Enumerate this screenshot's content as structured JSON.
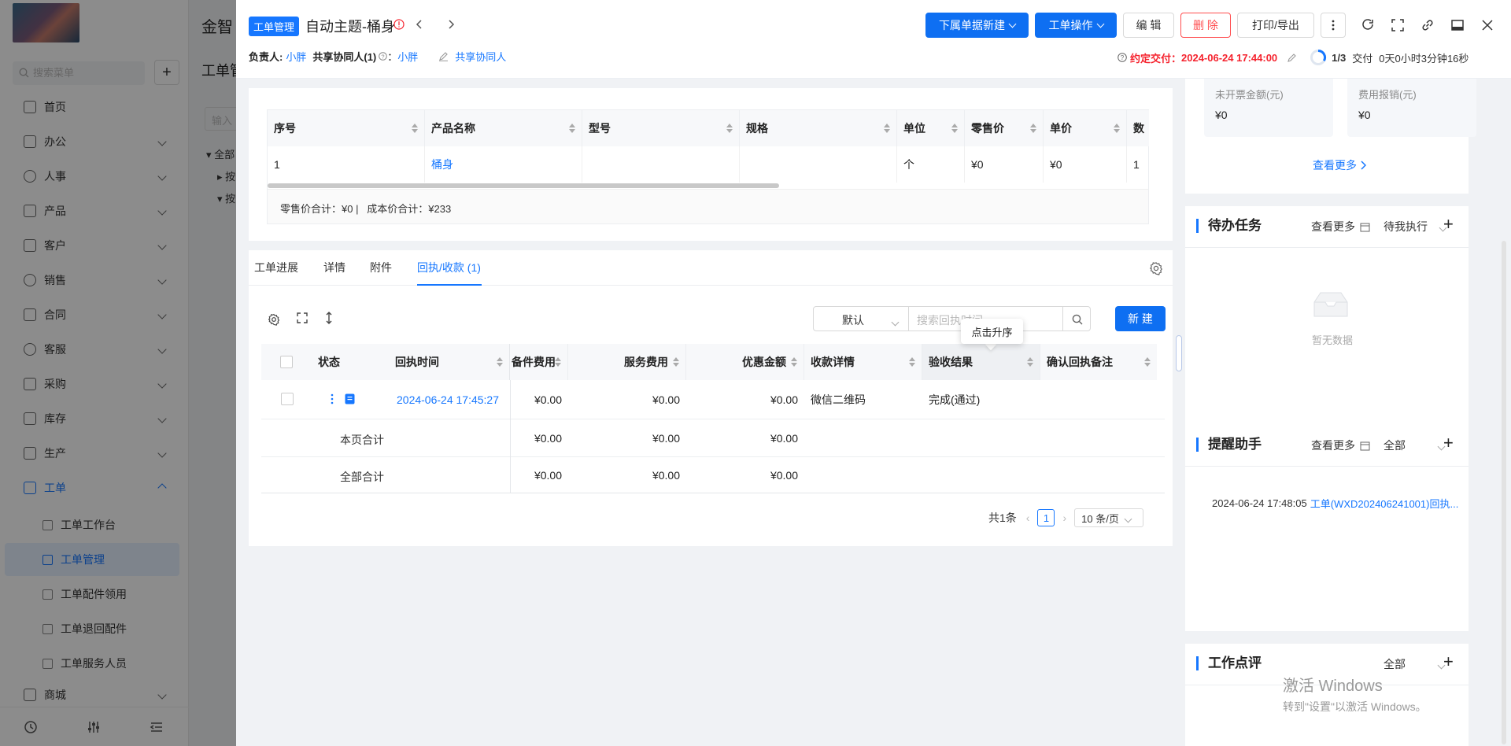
{
  "app": {
    "brand": "金智",
    "search_placeholder": "搜索菜单",
    "menu": [
      {
        "label": "首页"
      },
      {
        "label": "办公"
      },
      {
        "label": "人事"
      },
      {
        "label": "产品"
      },
      {
        "label": "客户"
      },
      {
        "label": "销售"
      },
      {
        "label": "合同"
      },
      {
        "label": "客服"
      },
      {
        "label": "采购"
      },
      {
        "label": "库存"
      },
      {
        "label": "生产"
      },
      {
        "label": "工单"
      },
      {
        "label": "商城"
      }
    ],
    "submenu": [
      {
        "label": "工单工作台"
      },
      {
        "label": "工单管理"
      },
      {
        "label": "工单配件领用"
      },
      {
        "label": "工单退回配件"
      },
      {
        "label": "工单服务人员"
      }
    ],
    "bg_title": "工单管",
    "bg_input_placeholder": "输入",
    "bg_tree": [
      "全部",
      "按",
      "按"
    ]
  },
  "header": {
    "tag": "工单管理",
    "title": "自动主题-桶身",
    "owner_label": "负责人:",
    "owner": "小胖",
    "collab_label": "共享协同人(1)",
    "collab_sep": "：",
    "collab": "小胖",
    "share_link": "共享协同人",
    "buttons": {
      "new_sub": "下属单据新建",
      "ops": "工单操作",
      "edit": "编 辑",
      "delete": "删 除",
      "print": "打印/导出"
    },
    "deadline_label": "约定交付：",
    "deadline": "2024-06-24 17:44:00",
    "progress": "1/3",
    "stage": "交付",
    "elapsed": "0天0小时3分钟16秒"
  },
  "product_table": {
    "columns": [
      "序号",
      "产品名称",
      "型号",
      "规格",
      "单位",
      "零售价",
      "单价",
      "数"
    ],
    "rows": [
      [
        "1",
        "桶身",
        "",
        "",
        "个",
        "¥0",
        "¥0",
        "1"
      ]
    ],
    "summary": "零售价合计：¥0 |   成本价合计：¥233"
  },
  "tabs": [
    {
      "label": "工单进展"
    },
    {
      "label": "详情"
    },
    {
      "label": "附件"
    },
    {
      "label": "回执/收款 (1)"
    }
  ],
  "receipt": {
    "sort_select": "默认",
    "search_placeholder": "搜索回执时间",
    "new_button": "新 建",
    "tooltip": "点击升序",
    "columns": [
      "状态",
      "回执时间",
      "备件费用",
      "服务费用",
      "优惠金额",
      "收款详情",
      "验收结果",
      "确认回执备注"
    ],
    "rows": [
      {
        "time": "2024-06-24 17:45:27",
        "parts": "¥0.00",
        "service": "¥0.00",
        "discount": "¥0.00",
        "detail": "微信二维码",
        "result": "完成(通过)",
        "note": ""
      }
    ],
    "page_total_label": "本页合计",
    "page_total": [
      "¥0.00",
      "¥0.00",
      "¥0.00"
    ],
    "all_total_label": "全部合计",
    "all_total": [
      "¥0.00",
      "¥0.00",
      "¥0.00"
    ],
    "pagination": {
      "total": "共1条",
      "page": "1",
      "page_size": "10 条/页"
    }
  },
  "right": {
    "stats": [
      {
        "label": "未开票金额(元)",
        "value": "¥0"
      },
      {
        "label": "费用报销(元)",
        "value": "¥0"
      }
    ],
    "see_more": "查看更多",
    "todo": {
      "title": "待办任务",
      "more": "查看更多",
      "filter": "待我执行",
      "empty": "暂无数据"
    },
    "reminder": {
      "title": "提醒助手",
      "more": "查看更多",
      "filter": "全部",
      "time": "2024-06-24 17:48:05",
      "text": "工单(WXD202406241001)回执..."
    },
    "review": {
      "title": "工作点评",
      "filter": "全部"
    }
  },
  "watermark": {
    "line1": "激活 Windows",
    "line2": "转到\"设置\"以激活 Windows。"
  },
  "colors": {
    "accent": "#1677ff",
    "danger": "#ff4d4f",
    "deadline": "#f5222d"
  }
}
